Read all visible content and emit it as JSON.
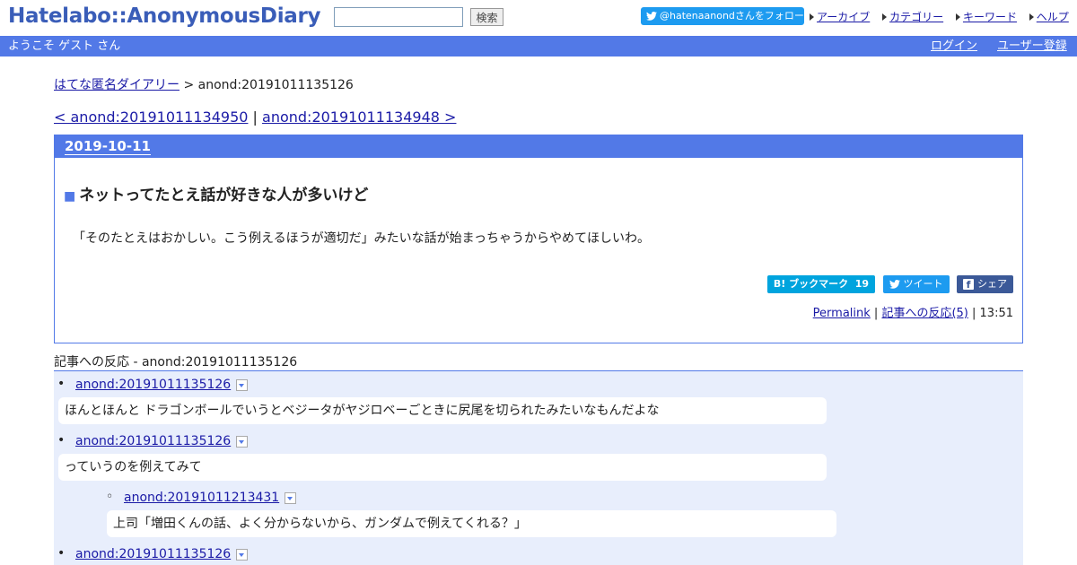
{
  "header": {
    "logo": "Hatelabo::AnonymousDiary",
    "search_value": "",
    "search_button": "検索",
    "twitter_follow": "@hatenaanondさんをフォロー",
    "nav": [
      "アーカイブ",
      "カテゴリー",
      "キーワード",
      "ヘルプ"
    ]
  },
  "bar": {
    "welcome": "ようこそ ゲスト さん",
    "login": "ログイン",
    "signup": "ユーザー登録"
  },
  "breadcrumb": {
    "home": "はてな匿名ダイアリー",
    "sep": ">",
    "current": "anond:20191011135126"
  },
  "nav_links": {
    "prev": "< anond:20191011134950",
    "sep": "|",
    "next": "anond:20191011134948 >"
  },
  "entry": {
    "date": "2019-10-11",
    "title_mark": "■",
    "title": "ネットってたとえ話が好きな人が多いけど",
    "body": "「そのたとえはおかしい。こう例えるほうが適切だ」みたいな話が始まっちゃうからやめてほしいわ。",
    "bookmark_label": "B! ブックマーク",
    "bookmark_count": "19",
    "tweet_label": "ツイート",
    "share_label": "シェア",
    "permalink": "Permalink",
    "reactions_link": "記事への反応(5)",
    "time": "13:51"
  },
  "reactions": {
    "header": "記事への反応 - anond:20191011135126",
    "items": [
      {
        "bullet": "•",
        "id": "anond:20191011135126",
        "text": "ほんとほんと ドラゴンボールでいうとベジータがヤジロベーごときに尻尾を切られたみたいなもんだよな"
      },
      {
        "bullet": "•",
        "id": "anond:20191011135126",
        "text": "っていうのを例えてみて"
      },
      {
        "bullet": "◦",
        "id": "anond:20191011213431",
        "text": "上司「増田くんの話、よく分からないから、ガンダムで例えてくれる？」"
      },
      {
        "bullet": "•",
        "id": "anond:20191011135126",
        "text": ""
      }
    ]
  },
  "colors": {
    "accent": "#5279e7",
    "twitter": "#1d9bf0",
    "hatena_bookmark": "#00a4de",
    "facebook": "#3b5998",
    "reactions_bg": "#e8eefc"
  }
}
